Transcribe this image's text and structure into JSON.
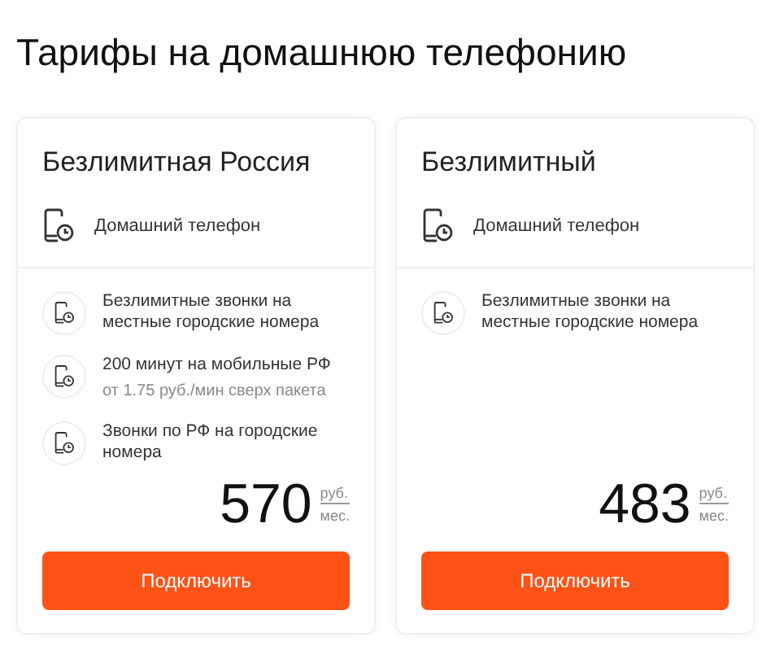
{
  "title": "Тарифы на домашнюю телефонию",
  "plans": [
    {
      "name": "Безлимитная Россия",
      "service": "Домашний телефон",
      "features": [
        {
          "text": "Безлимитные звонки на местные городские номера"
        },
        {
          "text": "200 минут на мобильные РФ",
          "note": "от 1.75 руб./мин сверх пакета"
        },
        {
          "text": "Звонки по РФ на городские номера"
        }
      ],
      "price": "570",
      "currency": "руб.",
      "period": "мес.",
      "button": "Подключить"
    },
    {
      "name": "Безлимитный",
      "service": "Домашний телефон",
      "features": [
        {
          "text": "Безлимитные звонки на местные городские номера"
        }
      ],
      "price": "483",
      "currency": "руб.",
      "period": "мес.",
      "button": "Подключить"
    }
  ]
}
